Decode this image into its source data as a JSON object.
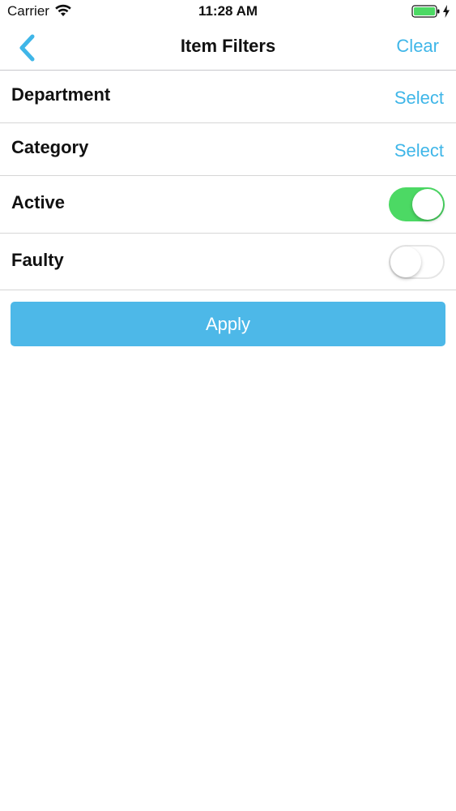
{
  "status_bar": {
    "carrier": "Carrier",
    "time": "11:28 AM",
    "battery_color": "#4cd964"
  },
  "nav": {
    "back_icon": "chevron-left-icon",
    "title": "Item Filters",
    "clear_label": "Clear",
    "accent_color": "#3fb6e8"
  },
  "filters": {
    "department": {
      "label": "Department",
      "action": "Select"
    },
    "category": {
      "label": "Category",
      "action": "Select"
    },
    "active": {
      "label": "Active",
      "on": true
    },
    "faulty": {
      "label": "Faulty",
      "on": false
    }
  },
  "apply": {
    "label": "Apply",
    "color": "#4db8e8"
  },
  "toggle_on_color": "#4cd964"
}
